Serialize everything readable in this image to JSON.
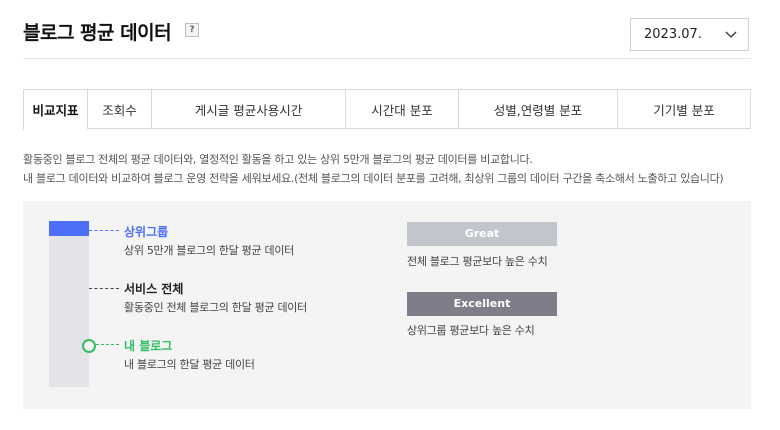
{
  "header": {
    "title": "블로그 평균 데이터",
    "help_label": "?",
    "date_value": "2023.07."
  },
  "tabs": [
    {
      "label": "비교지표",
      "active": true
    },
    {
      "label": "조회수",
      "active": false
    },
    {
      "label": "게시글 평균사용시간",
      "active": false
    },
    {
      "label": "시간대 분포",
      "active": false
    },
    {
      "label": "성별,연령별 분포",
      "active": false
    },
    {
      "label": "기기별 분포",
      "active": false
    }
  ],
  "description": {
    "line1": "활동중인 블로그 전체의 평균 데이터와, 열정적인 활동을 하고 있는 상위 5만개 블로그의 평균 데이터를 비교합니다.",
    "line2": "내 블로그 데이터와 비교하여 블로그 운영 전략을 세워보세요.(전체 블로그의 데이터 분포를 고려해, 최상위 그룹의 데이터 구간을 축소해서 노출하고 있습니다)"
  },
  "legend": {
    "top_group": {
      "title": "상위그룹",
      "subtitle": "상위 5만개 블로그의 한달 평균 데이터",
      "color": "#4d6ff7"
    },
    "service_all": {
      "title": "서비스 전체",
      "subtitle": "활동중인 전체 블로그의 한달 평균 데이터",
      "color": "#222222"
    },
    "my_blog": {
      "title": "내 블로그",
      "subtitle": "내 블로그의 한달 평균 데이터",
      "color": "#2fbe63"
    }
  },
  "badges": {
    "great": {
      "label": "Great",
      "note": "전체 블로그 평균보다 높은 수치",
      "color": "#c3c5cc"
    },
    "excellent": {
      "label": "Excellent",
      "note": "상위그룹 평균보다 높은 수치",
      "color": "#7d7e8a"
    }
  }
}
